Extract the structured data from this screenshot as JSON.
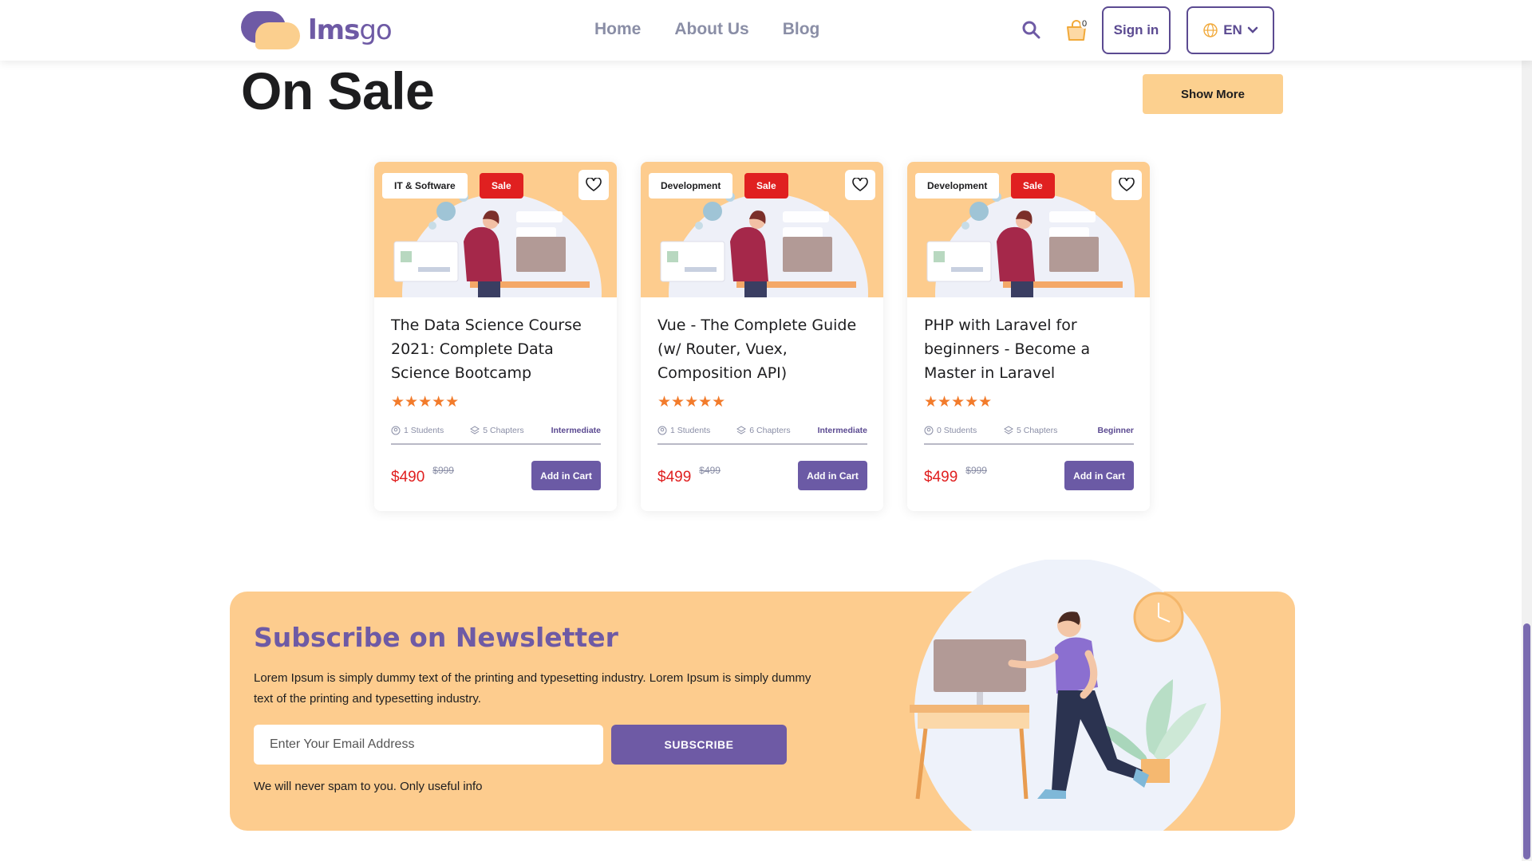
{
  "header": {
    "logo_text_a": "lms",
    "logo_text_b": "go",
    "nav": [
      "Home",
      "About Us",
      "Blog"
    ],
    "cart_count": "0",
    "signin_label": "Sign in",
    "lang_label": "EN"
  },
  "section": {
    "title": "On Sale",
    "show_more_label": "Show More"
  },
  "courses": [
    {
      "category": "IT & Software",
      "sale": "Sale",
      "title": "The Data Science Course 2021: Complete Data Science Bootcamp",
      "rating": 5,
      "students": "1 Students",
      "chapters": "5 Chapters",
      "level": "Intermediate",
      "price": "$490",
      "old_price": "$999",
      "cart_label": "Add in Cart"
    },
    {
      "category": "Development",
      "sale": "Sale",
      "title": "Vue - The Complete Guide (w/ Router, Vuex, Composition API)",
      "rating": 5,
      "students": "1 Students",
      "chapters": "6 Chapters",
      "level": "Intermediate",
      "price": "$499",
      "old_price": "$499",
      "cart_label": "Add in Cart"
    },
    {
      "category": "Development",
      "sale": "Sale",
      "title": "PHP with Laravel for beginners - Become a Master in Laravel",
      "rating": 5,
      "students": "0 Students",
      "chapters": "5 Chapters",
      "level": "Beginner",
      "price": "$499",
      "old_price": "$999",
      "cart_label": "Add in Cart"
    }
  ],
  "newsletter": {
    "title": "Subscribe on Newsletter",
    "text": "Lorem Ipsum is simply dummy text of the printing and typesetting industry. Lorem Ipsum is simply dummy text of the printing and typesetting industry.",
    "email_placeholder": "Enter Your Email Address",
    "subscribe_label": "SUBSCRIBE",
    "note": "We will never spam to you. Only useful info"
  },
  "colors": {
    "brand": "#6e5aa5",
    "accent": "#fdcc8e",
    "sale": "#e02020",
    "star": "#f27b2b"
  },
  "icons": [
    "search-icon",
    "cart-icon",
    "globe-icon",
    "chevron-down-icon",
    "heart-icon",
    "star-icon",
    "students-icon",
    "chapters-icon"
  ]
}
